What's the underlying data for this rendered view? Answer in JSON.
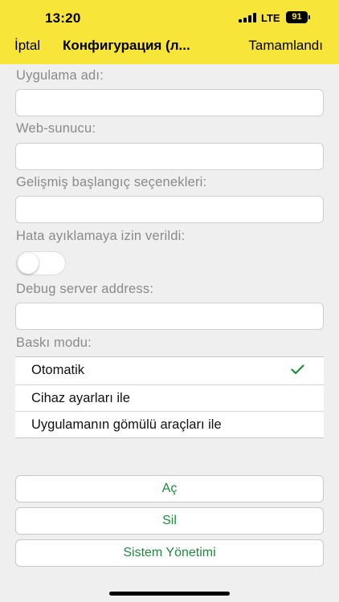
{
  "status_bar": {
    "time": "13:20",
    "network": "LTE",
    "battery": "91"
  },
  "nav": {
    "cancel_label": "İptal",
    "title": "Конфигурация (л...",
    "done_label": "Tamamlandı"
  },
  "form": {
    "app_name_label": "Uygulama adı:",
    "app_name_value": "",
    "web_server_label": "Web-sunucu:",
    "web_server_value": "",
    "startup_options_label": "Gelişmiş başlangıç seçenekleri:",
    "startup_options_value": "",
    "debug_allowed_label": "Hata ayıklamaya izin verildi:",
    "debug_allowed": false,
    "debug_server_label": "Debug server address:",
    "debug_server_value": "",
    "print_mode_label": "Baskı modu:",
    "print_modes": [
      {
        "label": "Otomatik",
        "selected": true
      },
      {
        "label": "Cihaz ayarları ile",
        "selected": false
      },
      {
        "label": "Uygulamanın gömülü araçları ile",
        "selected": false
      }
    ]
  },
  "actions": {
    "open_label": "Aç",
    "delete_label": "Sil",
    "admin_label": "Sistem Yönetimi"
  },
  "colors": {
    "header": "#f7e53a",
    "background": "#efefef",
    "accent_green": "#1e8a3c"
  },
  "icons": {
    "check": "checkmark-icon"
  }
}
